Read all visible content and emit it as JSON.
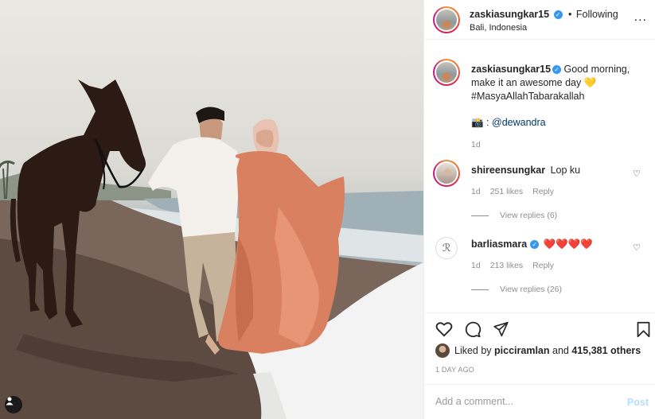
{
  "header": {
    "username": "zaskiasungkar15",
    "separator": "•",
    "follow_status": "Following",
    "location": "Bali, Indonesia",
    "more_label": "..."
  },
  "caption": {
    "username": "zaskiasungkar15",
    "text": "Good morning, make it an awesome day 💛 #MasyaAllahTabarakallah",
    "credit_prefix": "📸 :",
    "credit_mention": "@dewandra",
    "age": "1d"
  },
  "comments": [
    {
      "username": "shireensungkar",
      "verified": false,
      "text": "Lop ku",
      "age": "1d",
      "likes": "251 likes",
      "reply_label": "Reply",
      "view_replies": "View replies (6)"
    },
    {
      "username": "barliasmara",
      "verified": true,
      "text": "❤️❤️❤️❤️",
      "age": "1d",
      "likes": "213 likes",
      "reply_label": "Reply",
      "view_replies": "View replies (26)"
    }
  ],
  "likes": {
    "prefix": "Liked by",
    "first_liker": "picciramlan",
    "middle": "and",
    "others": "415,381 others"
  },
  "date": "1 DAY AGO",
  "add_comment": {
    "placeholder": "Add a comment...",
    "post_label": "Post"
  },
  "colors": {
    "verified": "#3897f0",
    "link": "#00376b",
    "post_disabled": "#b2dffc"
  },
  "icons": [
    "heart-icon",
    "comment-icon",
    "share-icon",
    "bookmark-icon",
    "user-tag-icon",
    "more-icon"
  ]
}
